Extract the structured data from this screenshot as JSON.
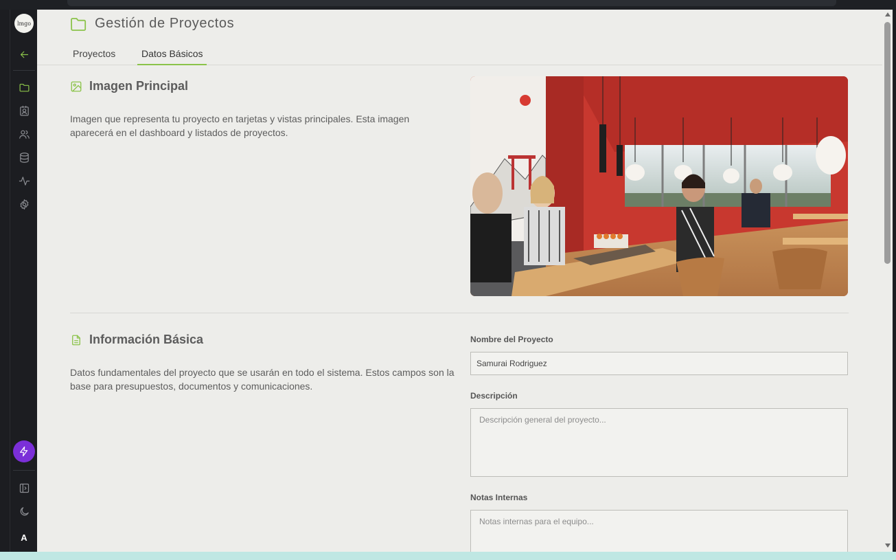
{
  "app": {
    "logo_text": "lmgo",
    "avatar_initial": "A"
  },
  "colors": {
    "accent": "#8bc34a",
    "sidebar_bg": "#1c1d21",
    "content_bg": "#ededea",
    "bolt_button": "#7b2fd8"
  },
  "sidebar": {
    "items": [
      {
        "icon": "arrow-left-icon",
        "name": "back"
      },
      {
        "icon": "folder-icon",
        "name": "projects",
        "active": true
      },
      {
        "icon": "contacts-icon",
        "name": "contacts"
      },
      {
        "icon": "users-icon",
        "name": "team"
      },
      {
        "icon": "database-icon",
        "name": "database"
      },
      {
        "icon": "activity-icon",
        "name": "activity"
      },
      {
        "icon": "gear-icon",
        "name": "settings"
      },
      {
        "icon": "bolt-icon",
        "name": "quick-action"
      },
      {
        "icon": "sidebar-toggle-icon",
        "name": "toggle-sidebar"
      },
      {
        "icon": "moon-icon",
        "name": "theme"
      }
    ]
  },
  "header": {
    "icon": "folder-icon",
    "title": "Gestión de Proyectos"
  },
  "tabs": [
    {
      "label": "Proyectos",
      "active": false
    },
    {
      "label": "Datos Básicos",
      "active": true
    }
  ],
  "image_section": {
    "icon": "image-icon",
    "title": "Imagen Principal",
    "description": "Imagen que representa tu proyecto en tarjetas y vistas principales. Esta imagen aparecerá en el dashboard y listados de proyectos."
  },
  "info_section": {
    "icon": "document-icon",
    "title": "Información Básica",
    "description": "Datos fundamentales del proyecto que se usarán en todo el sistema. Estos campos son la base para presupuestos, documentos y comunicaciones.",
    "fields": {
      "name": {
        "label": "Nombre del Proyecto",
        "value": "Samurai Rodriguez",
        "placeholder": ""
      },
      "description": {
        "label": "Descripción",
        "value": "",
        "placeholder": "Descripción general del proyecto..."
      },
      "notes": {
        "label": "Notas Internas",
        "value": "",
        "placeholder": "Notas internas para el equipo..."
      }
    }
  }
}
